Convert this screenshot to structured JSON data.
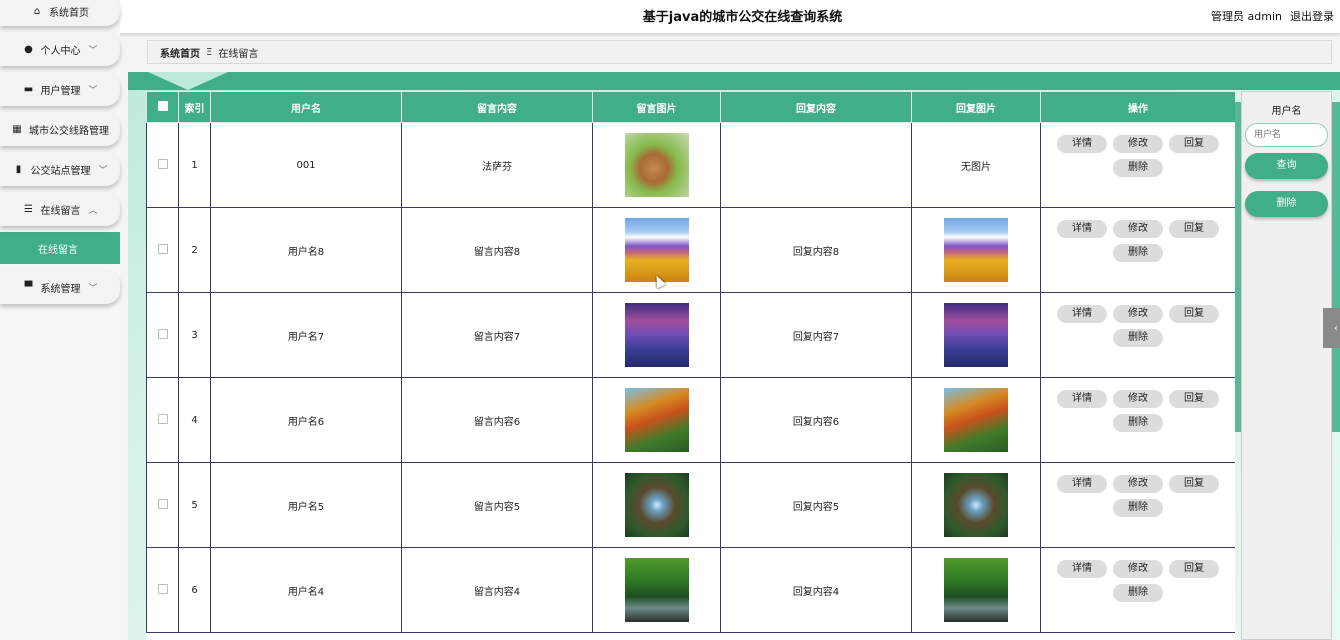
{
  "header": {
    "title": "基于java的城市公交在线查询系统",
    "user_label": "管理员 admin",
    "logout_label": "退出登录"
  },
  "sidebar": {
    "items": [
      {
        "label": "系统首页",
        "icon": "home-icon",
        "glyph": "⌂",
        "chevron": ""
      },
      {
        "label": "个人中心",
        "icon": "user-icon",
        "glyph": "●",
        "chevron": "﹀"
      },
      {
        "label": "用户管理",
        "icon": "users-icon",
        "glyph": "▬",
        "chevron": "﹀"
      },
      {
        "label": "城市公交线路管理",
        "icon": "grid-icon",
        "glyph": "▦",
        "chevron": ""
      },
      {
        "label": "公交站点管理",
        "icon": "clipboard-icon",
        "glyph": "▮",
        "chevron": "﹀"
      },
      {
        "label": "在线留言",
        "icon": "sliders-icon",
        "glyph": "☰",
        "chevron": "︿"
      },
      {
        "label": "系统管理",
        "icon": "monitor-icon",
        "glyph": "▀",
        "chevron": "﹀"
      }
    ],
    "active_sub": "在线留言"
  },
  "breadcrumb": {
    "home": "系统首页",
    "sep": "Ξ",
    "current": "在线留言"
  },
  "table": {
    "columns": [
      "索引",
      "用户名",
      "留言内容",
      "留言图片",
      "回复内容",
      "回复图片",
      "操作"
    ],
    "rows": [
      {
        "index": "1",
        "username": "001",
        "content": "法萨芬",
        "image": "rabbit",
        "reply": "",
        "reply_image": "",
        "reply_image_text": "无图片"
      },
      {
        "index": "2",
        "username": "用户名8",
        "content": "留言内容8",
        "image": "field",
        "reply": "回复内容8",
        "reply_image": "field",
        "reply_image_text": ""
      },
      {
        "index": "3",
        "username": "用户名7",
        "content": "留言内容7",
        "image": "winter",
        "reply": "回复内容7",
        "reply_image": "winter",
        "reply_image_text": ""
      },
      {
        "index": "4",
        "username": "用户名6",
        "content": "留言内容6",
        "image": "autumn",
        "reply": "回复内容6",
        "reply_image": "autumn",
        "reply_image_text": ""
      },
      {
        "index": "5",
        "username": "用户名5",
        "content": "留言内容5",
        "image": "forest",
        "reply": "回复内容5",
        "reply_image": "forest",
        "reply_image_text": ""
      },
      {
        "index": "6",
        "username": "用户名4",
        "content": "留言内容4",
        "image": "jungle",
        "reply": "回复内容4",
        "reply_image": "jungle",
        "reply_image_text": ""
      }
    ],
    "actions": {
      "detail": "详情",
      "edit": "修改",
      "reply": "回复",
      "delete": "删除"
    }
  },
  "search": {
    "label": "用户名",
    "placeholder": "用户名",
    "query_button": "查询",
    "delete_button": "删除"
  },
  "collapse_tab_glyph": "‹",
  "colors": {
    "accent": "#3fae89",
    "panel": "#bdeadb"
  }
}
